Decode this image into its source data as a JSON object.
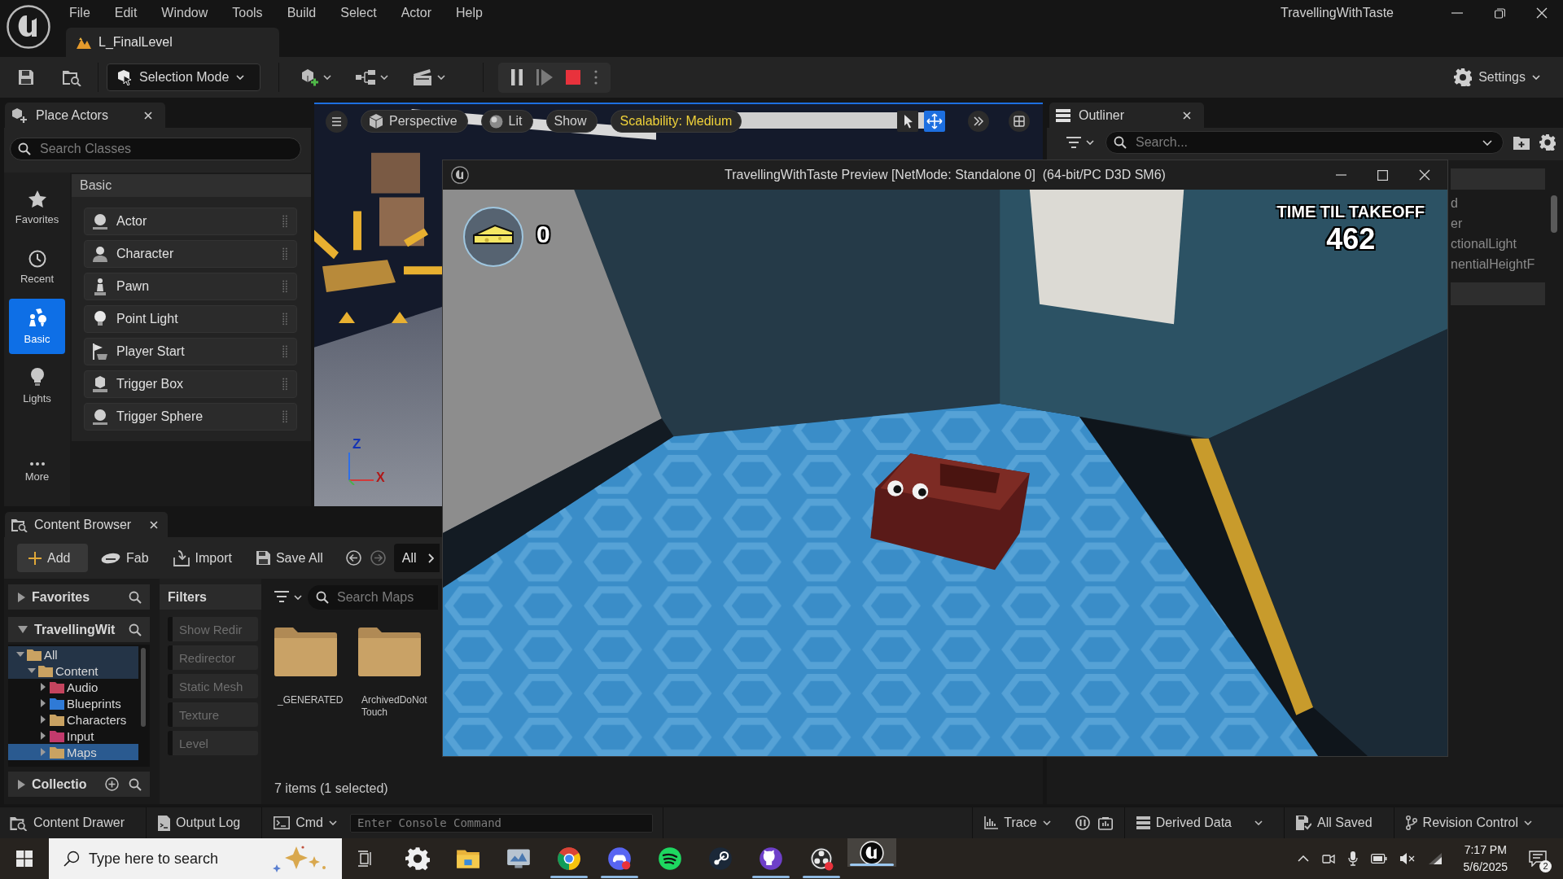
{
  "menu": [
    "File",
    "Edit",
    "Window",
    "Tools",
    "Build",
    "Select",
    "Actor",
    "Help"
  ],
  "window": {
    "title": "TravellingWithTaste"
  },
  "level_tab": {
    "label": "L_FinalLevel"
  },
  "toolbar": {
    "mode": "Selection Mode",
    "settings": "Settings"
  },
  "place_actors": {
    "tab": "Place Actors",
    "search": {
      "placeholder": "Search Classes"
    },
    "categories": [
      {
        "label": "Favorites",
        "selected": false
      },
      {
        "label": "Recent",
        "selected": false
      },
      {
        "label": "Basic",
        "selected": true
      },
      {
        "label": "Lights",
        "selected": false
      },
      {
        "label": "More",
        "selected": false
      }
    ],
    "section": "Basic",
    "items": [
      "Actor",
      "Character",
      "Pawn",
      "Point Light",
      "Player Start",
      "Trigger Box",
      "Trigger Sphere"
    ]
  },
  "viewport": {
    "view_mode": "Perspective",
    "lighting": "Lit",
    "show": "Show",
    "scalability": "Scalability: Medium",
    "tools": [
      {
        "selected": false
      },
      {
        "selected": true
      }
    ],
    "axis_labels": [
      "Z",
      "X"
    ]
  },
  "outliner": {
    "tab": "Outliner",
    "search": {
      "placeholder": "Search..."
    },
    "rows": [
      {
        "label": "d",
        "selected": false
      },
      {
        "label": "er",
        "selected": false
      },
      {
        "label": "ctionalLight",
        "selected": false
      },
      {
        "label": "nentialHeightF",
        "selected": false
      }
    ]
  },
  "preview": {
    "title": "TravellingWithTaste Preview [NetMode: Standalone 0]  (64-bit/PC D3D SM6)",
    "hud": {
      "score": "0",
      "timer_label": "TIME TIL TAKEOFF",
      "timer_value": "462"
    }
  },
  "content_browser": {
    "tab": "Content Browser",
    "actions": [
      "Add",
      "Fab",
      "Import",
      "Save All"
    ],
    "path": "All",
    "favorites": "Favorites",
    "project": "TravellingWit",
    "collections": "Collectio",
    "tree": [
      {
        "label": "All",
        "expanded": true,
        "selected": false,
        "color": "#c9a262",
        "children": [
          {
            "label": "Content",
            "expanded": true,
            "selected": false,
            "color": "#c9a262",
            "children": [
              {
                "label": "Audio",
                "expanded": false,
                "selected": false,
                "color": "#c4445e"
              },
              {
                "label": "Blueprints",
                "expanded": false,
                "selected": false,
                "color": "#2f7ad6"
              },
              {
                "label": "Characters",
                "expanded": false,
                "selected": false,
                "color": "#c9a262"
              },
              {
                "label": "Input",
                "expanded": false,
                "selected": false,
                "color": "#c23a6c"
              },
              {
                "label": "Maps",
                "expanded": false,
                "selected": true,
                "color": "#c9a262"
              }
            ]
          }
        ]
      }
    ],
    "filters": {
      "title": "Filters",
      "items": [
        {
          "label": "Show Redir",
          "checked": false
        },
        {
          "label": "Redirector",
          "checked": false
        },
        {
          "label": "Static Mesh",
          "checked": false
        },
        {
          "label": "Texture",
          "checked": false
        },
        {
          "label": "Level",
          "checked": false
        }
      ]
    },
    "search": {
      "placeholder": "Search Maps"
    },
    "assets": [
      "_GENERATED",
      "ArchivedDoNotTouch"
    ],
    "status": "7 items (1 selected)"
  },
  "status_bar": {
    "content_drawer": "Content Drawer",
    "output_log": "Output Log",
    "cmd": "Cmd",
    "console": {
      "placeholder": "Enter Console Command"
    },
    "trace": "Trace",
    "derived_data": "Derived Data",
    "save_state": "All Saved",
    "revision_control": "Revision Control"
  },
  "taskbar": {
    "search": {
      "placeholder": "Type here to search"
    },
    "apps": [
      {
        "running": false,
        "active": false
      },
      {
        "running": false,
        "active": false
      },
      {
        "running": false,
        "active": false
      },
      {
        "running": true,
        "active": false
      },
      {
        "running": true,
        "active": false
      },
      {
        "running": false,
        "active": false
      },
      {
        "running": false,
        "active": false
      },
      {
        "running": true,
        "active": false
      },
      {
        "running": true,
        "active": false
      },
      {
        "running": true,
        "active": true
      }
    ],
    "time": "7:17 PM",
    "date": "5/6/2025",
    "notifications": "2"
  }
}
